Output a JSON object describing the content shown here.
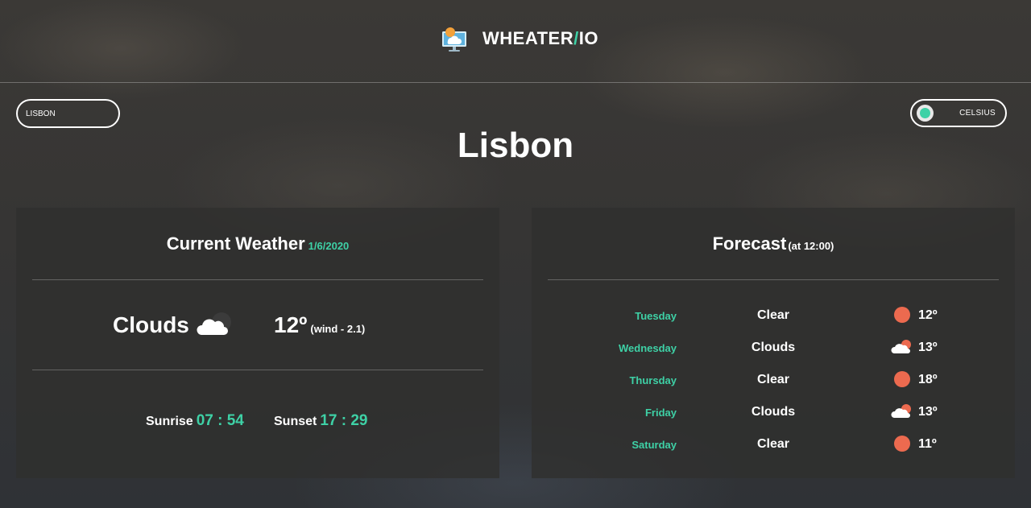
{
  "app": {
    "title_main": "WHEATER",
    "title_slash": "/",
    "title_suffix": "IO",
    "logo_icon": "weather-monitor-icon"
  },
  "search": {
    "value": "LISBON"
  },
  "unit_toggle": {
    "label": "CELSIUS",
    "accent": "#3ed1a6"
  },
  "city": "Lisbon",
  "current": {
    "title": "Current Weather",
    "date": "1/6/2020",
    "condition": "Clouds",
    "condition_icon": "clouds-icon",
    "temperature": "12º",
    "wind": "(wind - 2.1)",
    "sunrise_label": "Sunrise",
    "sunrise_time": "07 : 54",
    "sunset_label": "Sunset",
    "sunset_time": "17 : 29"
  },
  "forecast": {
    "title": "Forecast",
    "subtitle": "(at 12:00)",
    "days": [
      {
        "day": "Tuesday",
        "condition": "Clear",
        "icon": "sun-icon",
        "temp": "12º"
      },
      {
        "day": "Wednesday",
        "condition": "Clouds",
        "icon": "clouds-icon",
        "temp": "13º"
      },
      {
        "day": "Thursday",
        "condition": "Clear",
        "icon": "sun-icon",
        "temp": "18º"
      },
      {
        "day": "Friday",
        "condition": "Clouds",
        "icon": "clouds-icon",
        "temp": "13º"
      },
      {
        "day": "Saturday",
        "condition": "Clear",
        "icon": "sun-icon",
        "temp": "11º"
      }
    ]
  },
  "colors": {
    "accent": "#3ed1a6",
    "sun": "#ec6a4f"
  }
}
